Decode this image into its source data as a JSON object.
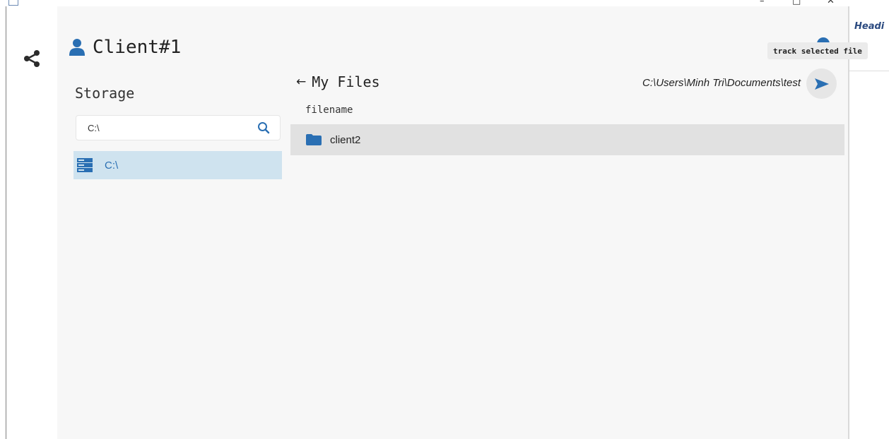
{
  "window": {
    "minimize_glyph": "–",
    "maximize_glyph": "□",
    "close_glyph": "✕"
  },
  "client": {
    "name": "Client#1"
  },
  "storage": {
    "title": "Storage",
    "search_value": "C:\\",
    "drives": [
      {
        "label": "C:\\"
      }
    ]
  },
  "files": {
    "back_glyph": "←",
    "title": "My Files",
    "path": "C:\\Users\\Minh Tri\\Documents\\test",
    "column_header": "filename",
    "rows": [
      {
        "name": "client2",
        "type": "folder"
      }
    ]
  },
  "tooltip": {
    "text": "track selected file"
  },
  "side_document": {
    "heading": "Headi"
  },
  "colors": {
    "accent": "#2a6fb3",
    "selected_bg": "#cfe3ef",
    "row_bg": "#e1e1e1",
    "main_bg": "#f7f7f7"
  },
  "icons": {
    "nav": "share-icon",
    "client": "user-icon",
    "search": "search-icon",
    "drive": "storage-drive-icon",
    "folder": "folder-icon",
    "send": "send-icon",
    "help": "help-icon"
  }
}
